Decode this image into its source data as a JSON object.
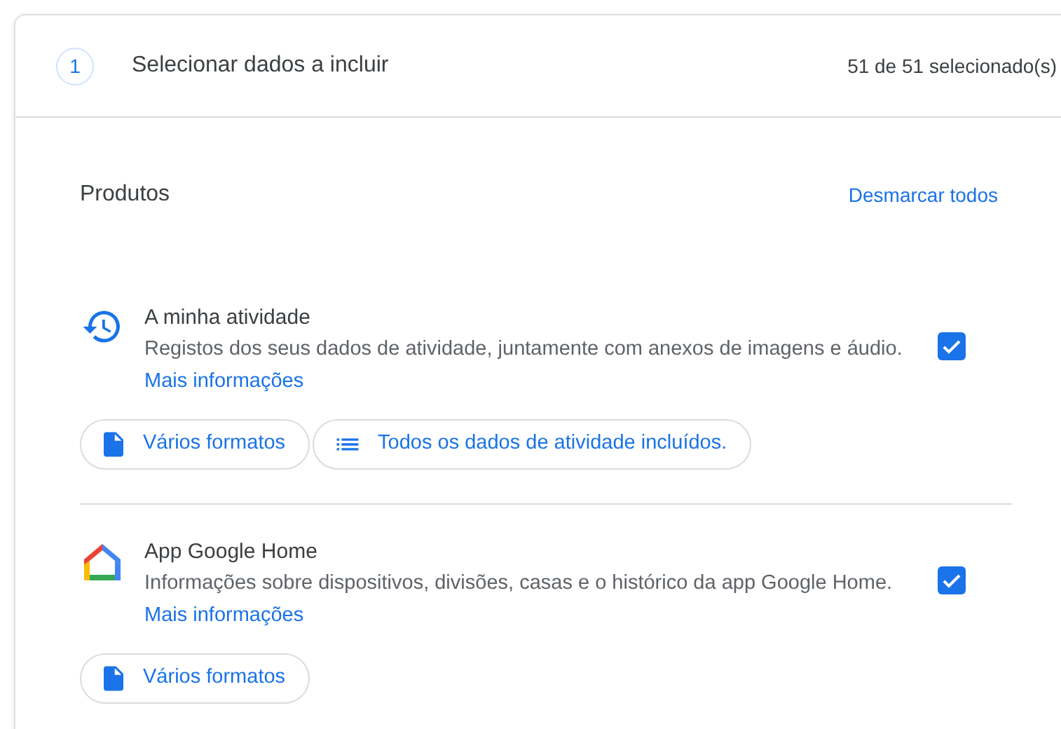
{
  "step": {
    "number": "1",
    "title": "Selecionar dados a incluir",
    "count": "51 de 51 selecionado(s)"
  },
  "section": {
    "title": "Produtos",
    "action": "Desmarcar todos"
  },
  "products": [
    {
      "kind": "history",
      "name": "A minha atividade",
      "description": "Registos dos seus dados de atividade, juntamente com anexos de imagens e áudio.",
      "link": "Mais informações",
      "checked": true,
      "chips": [
        {
          "kind": "file",
          "label": "Vários formatos"
        },
        {
          "kind": "list",
          "label": "Todos os dados de atividade incluídos."
        }
      ]
    },
    {
      "kind": "home",
      "name": "App Google Home",
      "description": "Informações sobre dispositivos, divisões, casas e o histórico da app Google Home.",
      "link": "Mais informações",
      "checked": true,
      "chips": [
        {
          "kind": "file",
          "label": "Vários formatos"
        }
      ]
    }
  ]
}
